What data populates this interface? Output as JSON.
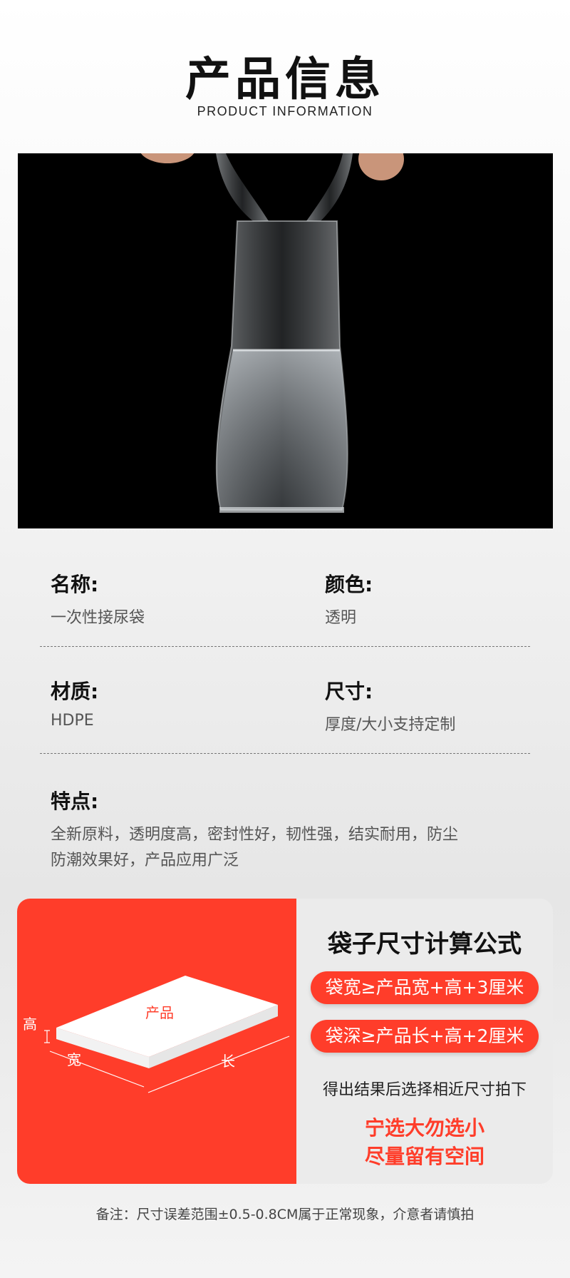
{
  "header": {
    "title": "产品信息",
    "subtitle": "PRODUCT INFORMATION"
  },
  "specs": {
    "name_label": "名称:",
    "name_value": "一次性接尿袋",
    "color_label": "颜色:",
    "color_value": "透明",
    "material_label": "材质:",
    "material_value": "HDPE",
    "size_label": "尺寸:",
    "size_value": "厚度/大小支持定制",
    "features_label": "特点:",
    "features_line1": "全新原料，透明度高，密封性好，韧性强，结实耐用，防尘",
    "features_line2": "防潮效果好，产品应用广泛"
  },
  "diagram": {
    "product_label": "产品",
    "height_label": "高",
    "width_label": "宽",
    "length_label": "长"
  },
  "formula": {
    "title": "袋子尺寸计算公式",
    "rule1": "袋宽≥产品宽+高+3厘米",
    "rule2": "袋深≥产品长+高+2厘米",
    "tip": "得出结果后选择相近尺寸拍下",
    "advice1": "宁选大勿选小",
    "advice2": "尽量留有空间"
  },
  "note": "备注：尺寸误差范围±0.5-0.8CM属于正常现象，介意者请慎拍",
  "colors": {
    "accent": "#ff3d2a",
    "photo_bg": "#000000"
  }
}
